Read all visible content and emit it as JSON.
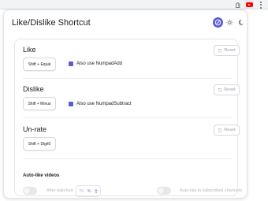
{
  "toolbar": {
    "extensions_icon": "puzzle-icon",
    "extension_icon": "youtube-logo-icon",
    "menu_icon": "more-vert-icon"
  },
  "popup": {
    "title": "Like/Dislike Shortcut",
    "theme": {
      "options": [
        "auto",
        "light",
        "dark"
      ],
      "selected": "auto",
      "accent": "#5b5bd6"
    }
  },
  "sections": {
    "like": {
      "label": "Like",
      "reset_label": "Reset",
      "shortcut": "Shift + Equal",
      "checkbox_label": "Also use NumpadAdd",
      "checkbox_checked": true
    },
    "dislike": {
      "label": "Dislike",
      "reset_label": "Reset",
      "shortcut": "Shift + Minus",
      "checkbox_label": "Also use NumpadSubtract",
      "checkbox_checked": true
    },
    "unrate": {
      "label": "Un-rate",
      "reset_label": "Reset",
      "shortcut": "Shift + Digit0"
    }
  },
  "auto_like": {
    "title": "Auto-like videos",
    "after_watched": {
      "label": "After watched",
      "enabled": false,
      "value": "70",
      "unit": "%"
    },
    "subscribed": {
      "label": "Auto-like in subscribed channels",
      "enabled": false
    }
  }
}
